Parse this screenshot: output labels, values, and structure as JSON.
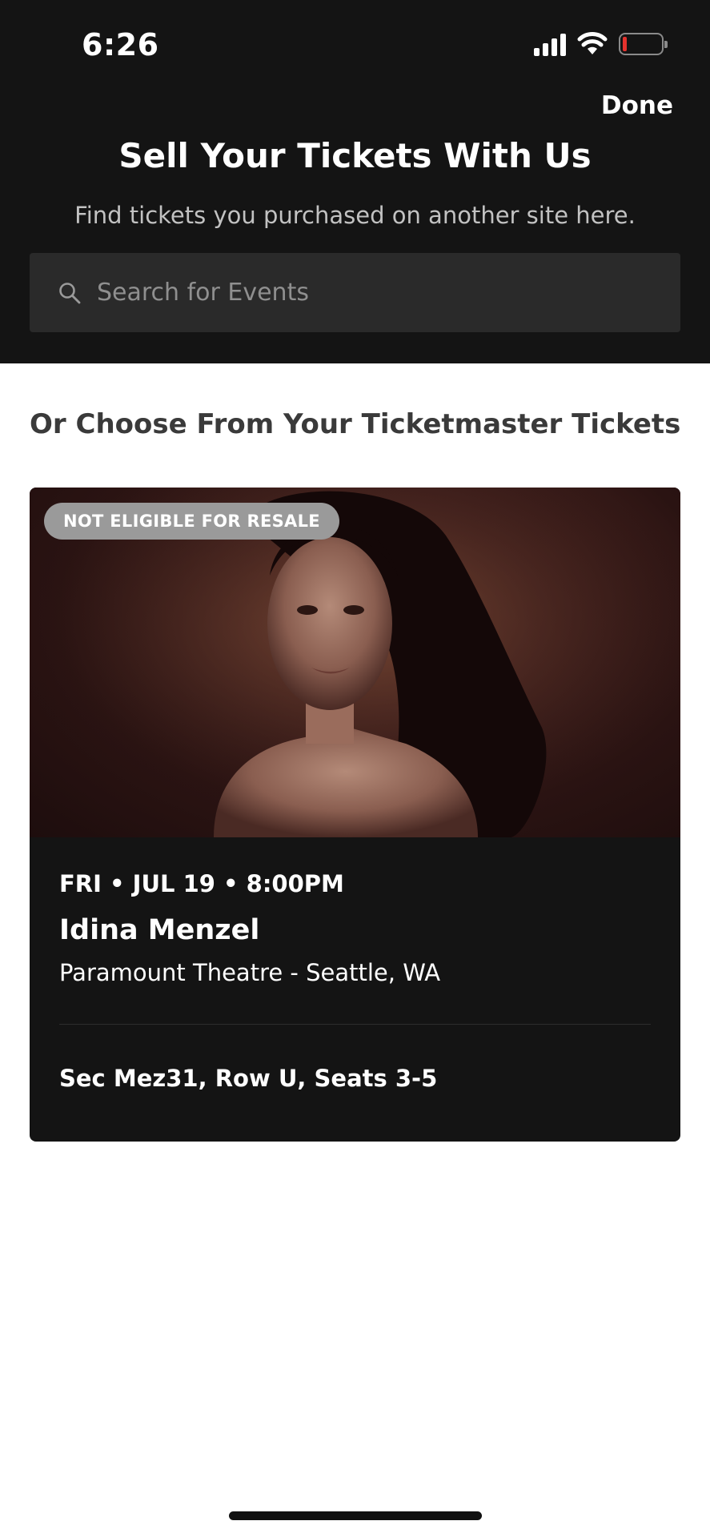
{
  "status_bar": {
    "time": "6:26"
  },
  "header": {
    "done_label": "Done",
    "title": "Sell Your Tickets With Us",
    "subtitle": "Find tickets you purchased on another site here."
  },
  "search": {
    "placeholder": "Search for Events",
    "value": ""
  },
  "section": {
    "title": "Or Choose From Your Ticketmaster Tickets"
  },
  "ticket": {
    "badge": "NOT ELIGIBLE FOR RESALE",
    "date": "FRI • JUL 19 • 8:00PM",
    "name": "Idina Menzel",
    "venue": "Paramount Theatre - Seattle, WA",
    "seats": "Sec Mez31, Row U, Seats 3-5"
  },
  "colors": {
    "header_bg": "#141414",
    "card_bg": "#141414",
    "badge_bg": "#9a9a9a",
    "battery_low": "#e5322d"
  },
  "icons": [
    "cellular-signal-icon",
    "wifi-icon",
    "battery-icon",
    "search-icon"
  ]
}
